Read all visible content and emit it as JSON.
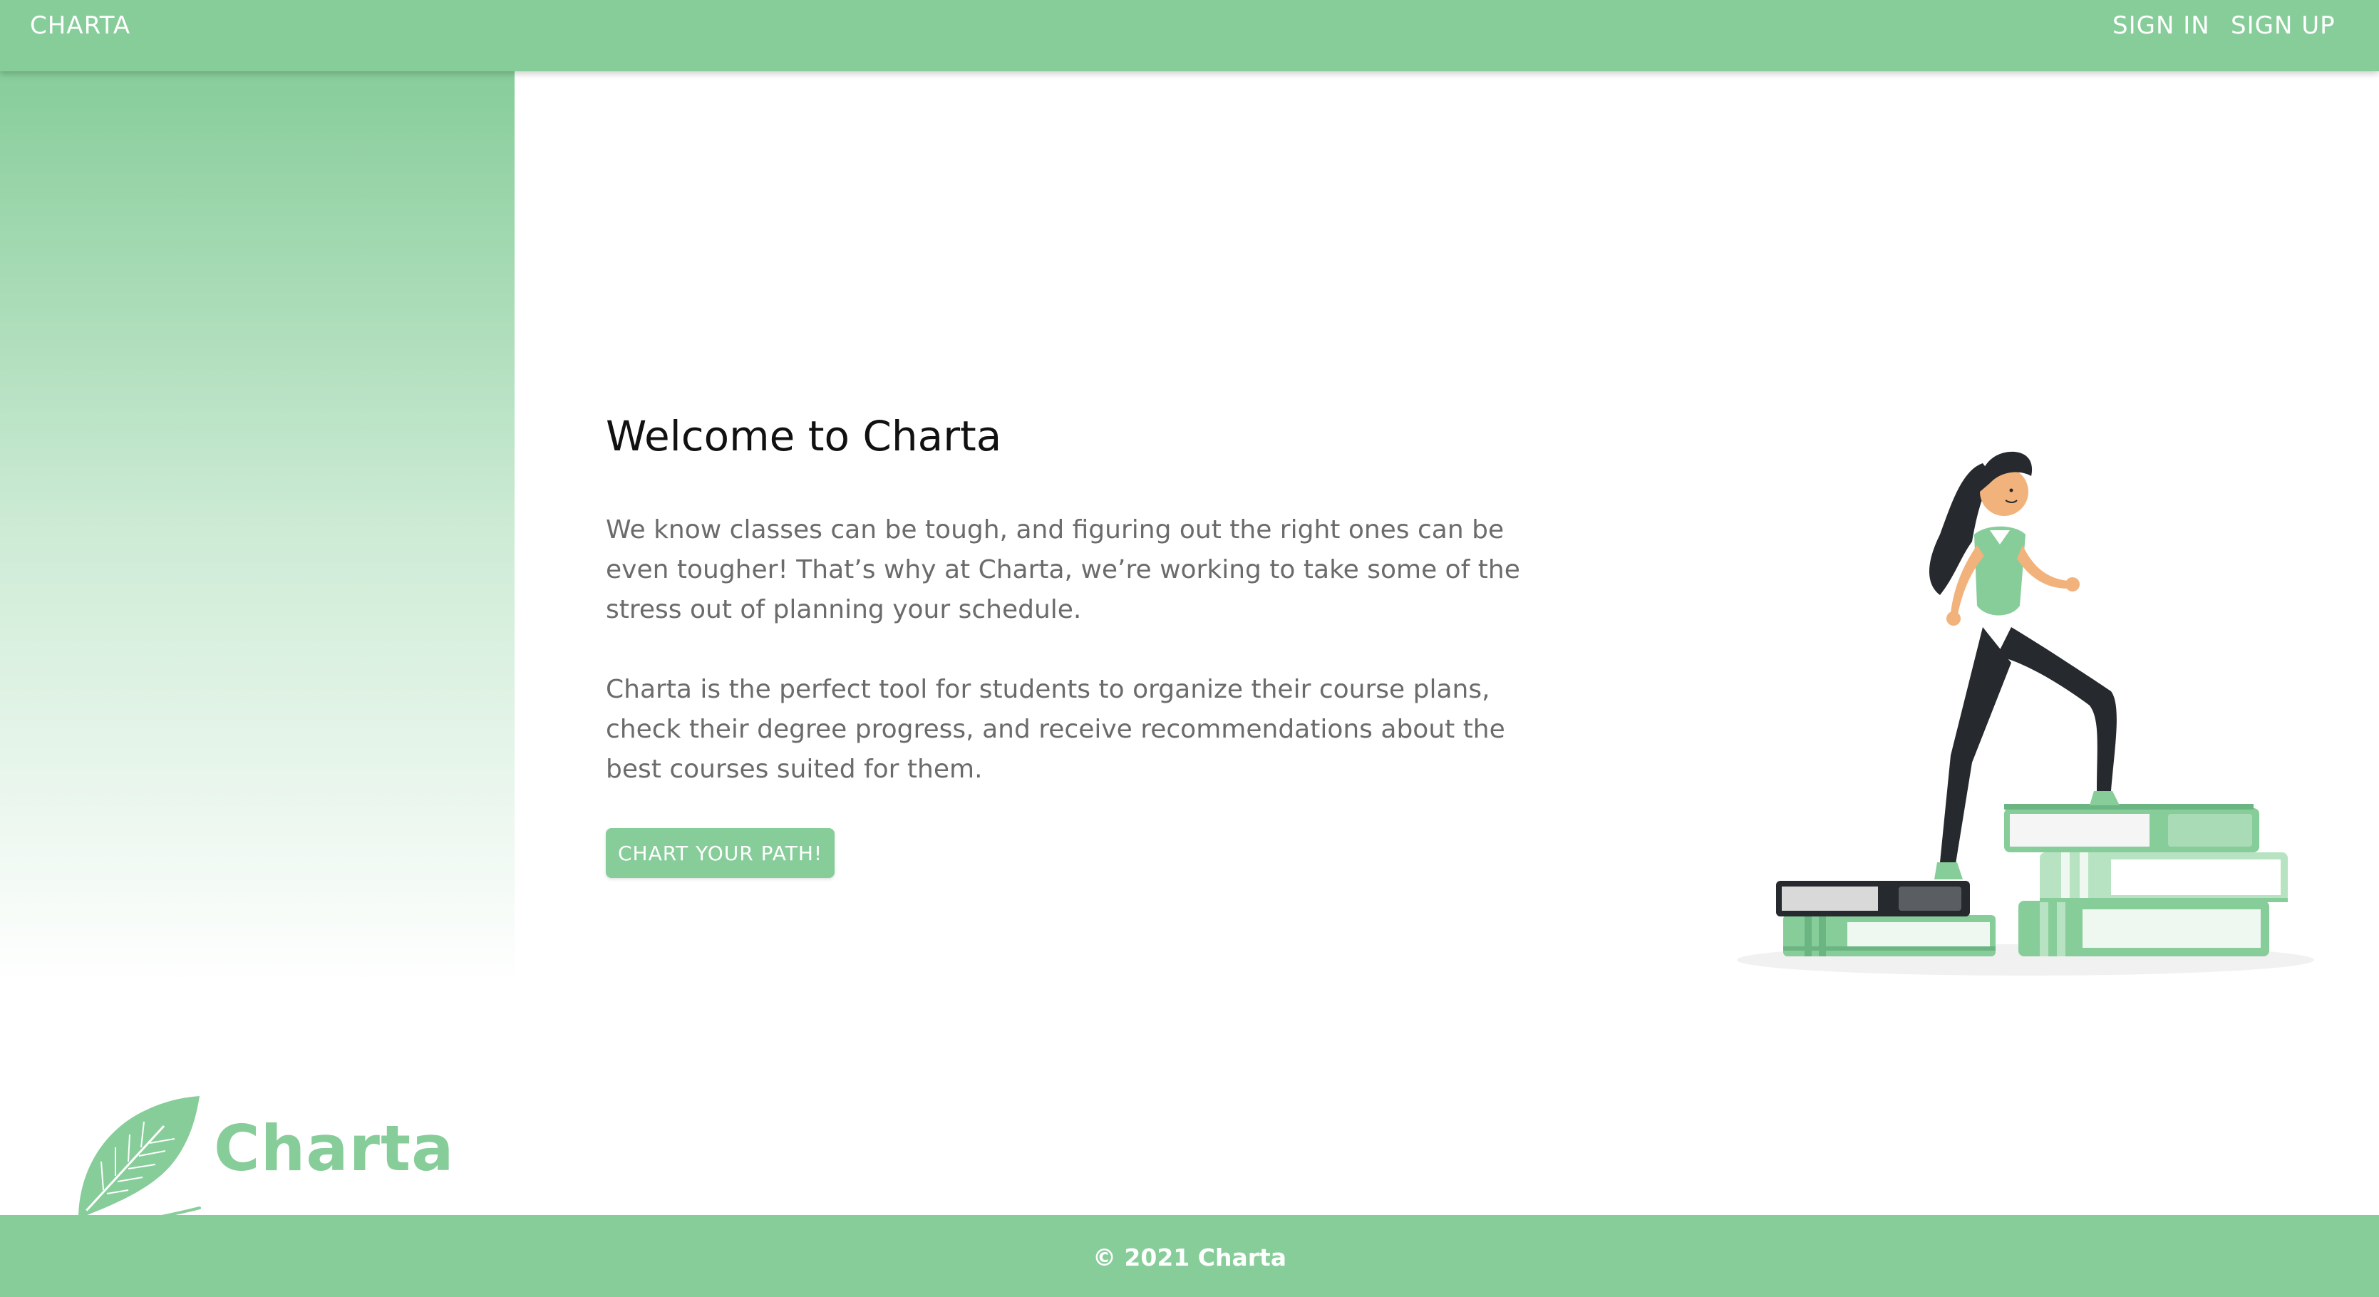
{
  "nav": {
    "brand": "CHARTA",
    "sign_in": "SIGN IN",
    "sign_up": "SIGN UP"
  },
  "sidebar": {
    "logo_text": "Charta",
    "logo_icon": "feather-quill-icon"
  },
  "hero": {
    "title": "Welcome to Charta",
    "paragraph_1": "We know classes can be tough, and figuring out the right ones can be even tougher! That’s why at Charta, we’re working to take some of the stress out of planning your schedule.",
    "paragraph_2": "Charta is the perfect tool for students to organize their course plans, check their degree progress, and receive recommendations about the best courses suited for them.",
    "cta_label": "CHART YOUR PATH!",
    "illustration": "woman-climbing-books-illustration"
  },
  "footer": {
    "copyright": "© 2021 Charta"
  },
  "colors": {
    "brand_green": "#87cd9a",
    "text_gray": "#6b6b6b",
    "dark": "#26292d"
  }
}
